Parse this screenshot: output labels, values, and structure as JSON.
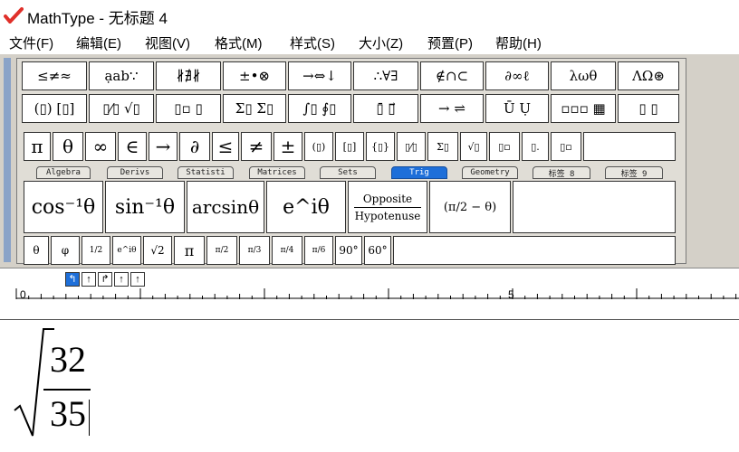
{
  "window": {
    "title": "MathType - 无标题 4"
  },
  "menu": [
    "文件(F)",
    "编辑(E)",
    "视图(V)",
    "格式(M)",
    "样式(S)",
    "大小(Z)",
    "预置(P)",
    "帮助(H)"
  ],
  "toolbar_row1": [
    "≤≠≈",
    "ạab∵",
    "∦∄∦",
    "±•⊗",
    "→⇔↓",
    "∴∀∃",
    "∉∩⊂",
    "∂∞ℓ",
    "λωθ",
    "ΛΩ⊛"
  ],
  "toolbar_row2": [
    "(▯) [▯]",
    "▯⁄▯ √▯",
    "▯▫ ▯",
    "Σ▯ Σ▯",
    "∫▯ ∮▯",
    "▯̄ ▯⃗",
    "→ ⇌",
    "Ū Ụ",
    "▫▫▫ ▦",
    "▯ ▯"
  ],
  "symbol_row": [
    "π",
    "θ",
    "∞",
    "∈",
    "→",
    "∂",
    "≤",
    "≠",
    "±",
    "(▯)",
    "[▯]",
    "{▯}",
    "▯⁄▯",
    "Σ▯",
    "√▯",
    "▯▫",
    "▯.",
    "▯▫"
  ],
  "tabs": [
    {
      "label": "Algebra",
      "active": false
    },
    {
      "label": "Derivs",
      "active": false
    },
    {
      "label": "Statisti",
      "active": false
    },
    {
      "label": "Matrices",
      "active": false
    },
    {
      "label": "Sets",
      "active": false
    },
    {
      "label": "Trig",
      "active": true
    },
    {
      "label": "Geometry",
      "active": false
    },
    {
      "label": "标签 8",
      "active": false
    },
    {
      "label": "标签 9",
      "active": false
    }
  ],
  "templates": {
    "arccos": "cos⁻¹θ",
    "arcsin_sup": "sin⁻¹θ",
    "arcsin": "arcsinθ",
    "euler": "e^iθ",
    "opposite": "Opposite",
    "hypotenuse": "Hypotenuse",
    "complement": "(π/2 − θ)"
  },
  "small_row": [
    "θ",
    "φ",
    "1/2",
    "e^iθ",
    "√2",
    "π",
    "π/2",
    "π/3",
    "π/4",
    "π/6",
    "90°",
    "60°"
  ],
  "tabstops": [
    "↰",
    "↑",
    "↱",
    "↑",
    "↑"
  ],
  "ruler": {
    "labels": [
      "0",
      "5"
    ]
  },
  "document": {
    "numerator": "32",
    "denominator": "35"
  },
  "colors": {
    "accent": "#1e6fd9",
    "logo": "#e0302a",
    "palette_bg": "#d4d0c8"
  }
}
